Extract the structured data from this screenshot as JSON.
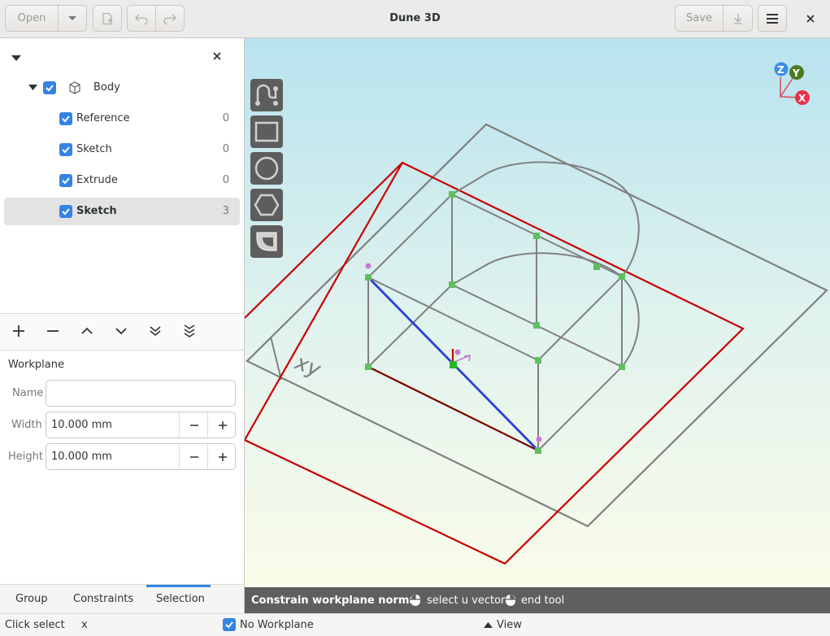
{
  "header": {
    "title": "Dune 3D",
    "open_label": "Open",
    "save_label": "Save"
  },
  "tree": {
    "items": [
      {
        "label": "Body"
      },
      {
        "label": "Reference",
        "count": "0"
      },
      {
        "label": "Sketch",
        "count": "0"
      },
      {
        "label": "Extrude",
        "count": "0"
      },
      {
        "label": "Sketch",
        "count": "3"
      }
    ]
  },
  "properties": {
    "section": "Workplane",
    "name_label": "Name",
    "name_value": "",
    "width_label": "Width",
    "width_value": "10.000 mm",
    "height_label": "Height",
    "height_value": "10.000 mm"
  },
  "tabs": [
    "Group",
    "Constraints",
    "Selection"
  ],
  "viewport": {
    "plane_label": "xy",
    "axes": {
      "x": "X",
      "y": "Y",
      "z": "Z"
    },
    "axis_colors": {
      "x": "#e8334a",
      "y": "#4e7a1f",
      "z": "#3a8ee6"
    }
  },
  "status": {
    "action": "Constrain workplane normal",
    "hint1": "select u vector",
    "hint2": "end tool"
  },
  "bottom": {
    "mode": "Click select",
    "x_label": "x",
    "workplane": "No Workplane",
    "view": "View"
  }
}
